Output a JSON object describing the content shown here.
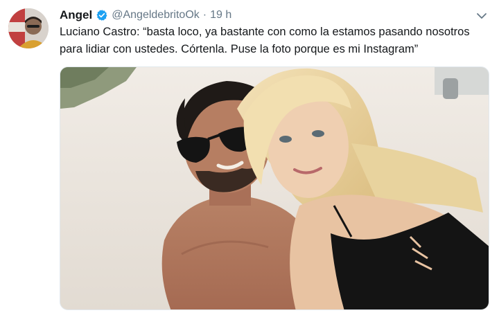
{
  "tweet": {
    "display_name": "Angel",
    "handle": "@AngeldebritoOk",
    "separator": "·",
    "time": "19 h",
    "text": "Luciano Castro: “basta loco, ya bastante con como la estamos pasando nosotros\npara lidiar con ustedes. Córtenla. Puse la foto porque es mi Instagram”",
    "media_alt": "Selfie photo of a man with sunglasses and a blonde woman on a beach"
  },
  "icons": {
    "verified": "verified-badge-icon",
    "menu": "chevron-down-icon"
  },
  "colors": {
    "verified_blue": "#1da1f2",
    "secondary_text": "#657786",
    "primary_text": "#14171a"
  }
}
